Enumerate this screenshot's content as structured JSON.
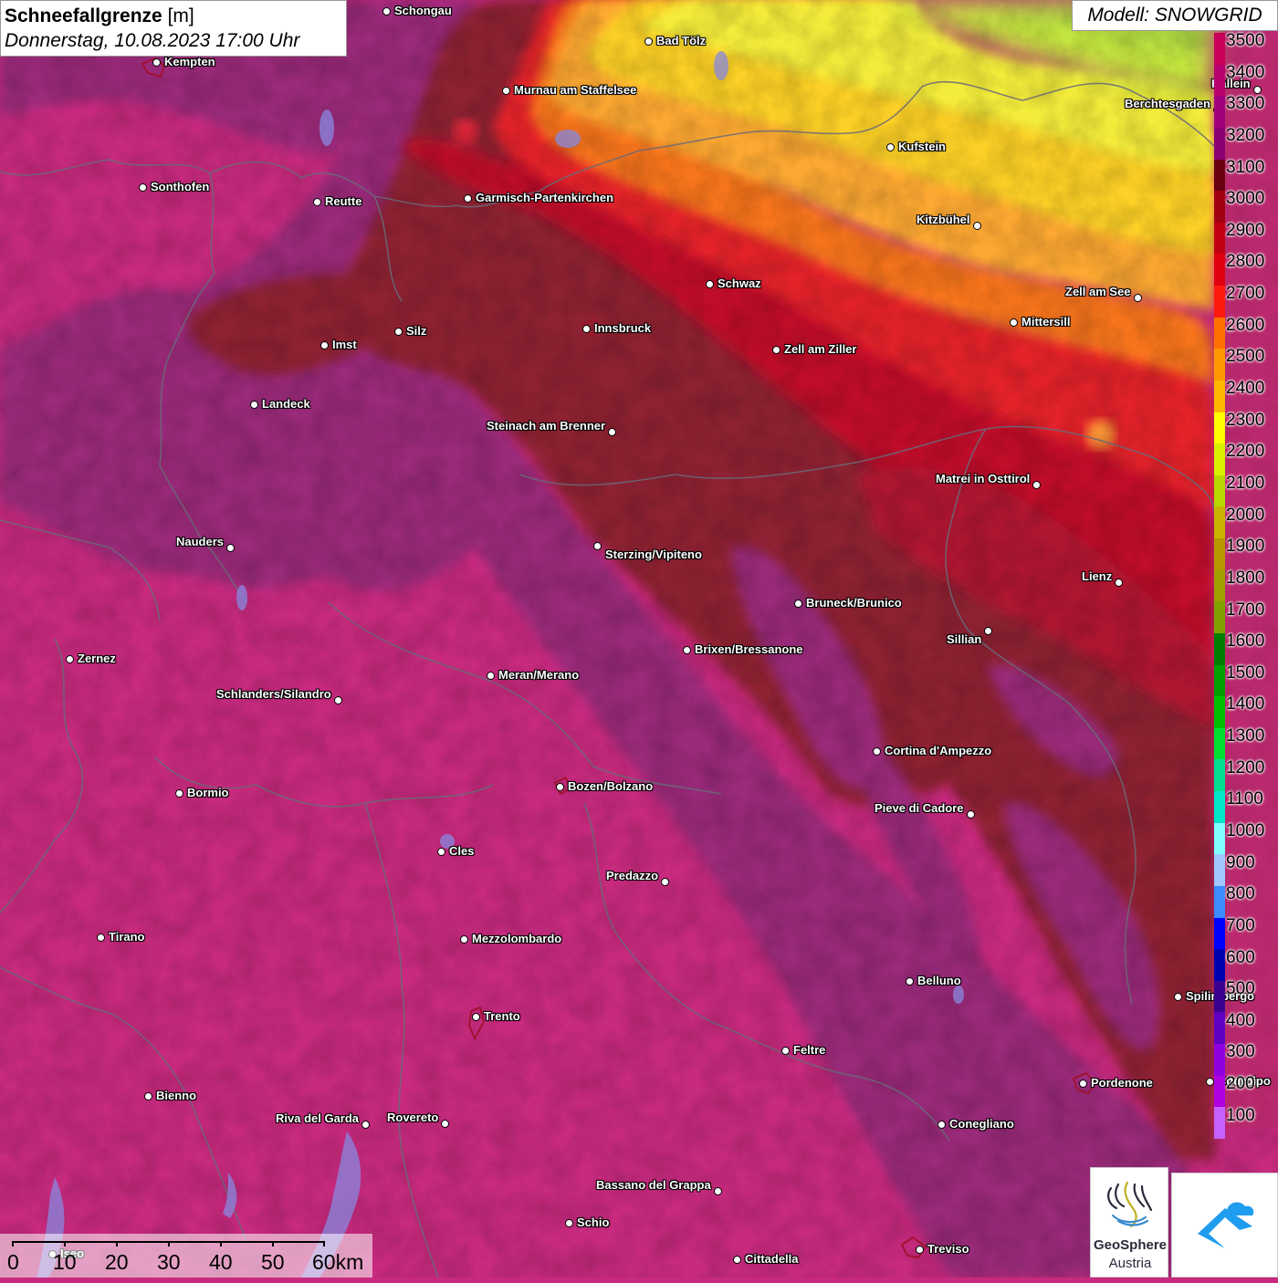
{
  "header": {
    "title": "Schneefallgrenze",
    "unit": "[m]",
    "datetime": "Donnerstag, 10.08.2023 17:00 Uhr",
    "model": "Modell: SNOWGRID"
  },
  "legend": {
    "labels": [
      "3500",
      "3400",
      "3300",
      "3200",
      "3100",
      "3000",
      "2900",
      "2800",
      "2700",
      "2600",
      "2500",
      "2400",
      "2300",
      "2200",
      "2100",
      "2000",
      "1900",
      "1800",
      "1700",
      "1600",
      "1500",
      "1400",
      "1300",
      "1200",
      "1100",
      "1000",
      "900",
      "800",
      "700",
      "600",
      "500",
      "400",
      "300",
      "200",
      "100"
    ],
    "colors": [
      "#c8005a",
      "#b8006e",
      "#a0007c",
      "#8a0072",
      "#6a0010",
      "#a00010",
      "#c00010",
      "#e00010",
      "#ff1a10",
      "#ff7000",
      "#ff9800",
      "#ffb800",
      "#ffff00",
      "#d8f000",
      "#b8d800",
      "#c8b400",
      "#b89800",
      "#a0a000",
      "#80a000",
      "#008000",
      "#00a000",
      "#00c000",
      "#00e030",
      "#00e090",
      "#00e8c8",
      "#80ffff",
      "#a0c8ff",
      "#3c8cff",
      "#0000ff",
      "#0000b0",
      "#3c0090",
      "#6000c0",
      "#9000e0",
      "#b000e0",
      "#c860ff"
    ]
  },
  "scalebar": {
    "labels": [
      "0",
      "10",
      "20",
      "30",
      "40",
      "50",
      "60km"
    ]
  },
  "cities": [
    {
      "name": "Schongau"
    },
    {
      "name": "Kempten"
    },
    {
      "name": "Bad Tölz"
    },
    {
      "name": "Murnau am Staffelsee"
    },
    {
      "name": "Hallein"
    },
    {
      "name": "Berchtesgaden"
    },
    {
      "name": "Kufstein"
    },
    {
      "name": "Sonthofen"
    },
    {
      "name": "Reutte"
    },
    {
      "name": "Garmisch-Partenkirchen"
    },
    {
      "name": "Kitzbühel"
    },
    {
      "name": "Schwaz"
    },
    {
      "name": "Zell am See"
    },
    {
      "name": "Mittersill"
    },
    {
      "name": "Imst"
    },
    {
      "name": "Silz"
    },
    {
      "name": "Innsbruck"
    },
    {
      "name": "Zell am Ziller"
    },
    {
      "name": "Landeck"
    },
    {
      "name": "Steinach am Brenner"
    },
    {
      "name": "Matrei in Osttirol"
    },
    {
      "name": "Nauders"
    },
    {
      "name": "Sterzing/Vipiteno"
    },
    {
      "name": "Lienz"
    },
    {
      "name": "Bruneck/Brunico"
    },
    {
      "name": "Sillian"
    },
    {
      "name": "Brixen/Bressanone"
    },
    {
      "name": "Zernez"
    },
    {
      "name": "Meran/Merano"
    },
    {
      "name": "Schlanders/Silandro"
    },
    {
      "name": "Cortina d'Ampezzo"
    },
    {
      "name": "Bozen/Bolzano"
    },
    {
      "name": "Bormio"
    },
    {
      "name": "Pieve di Cadore"
    },
    {
      "name": "Cles"
    },
    {
      "name": "Predazzo"
    },
    {
      "name": "Tirano"
    },
    {
      "name": "Mezzolombardo"
    },
    {
      "name": "Belluno"
    },
    {
      "name": "Spilimbergo"
    },
    {
      "name": "Trento"
    },
    {
      "name": "Feltre"
    },
    {
      "name": "Pordenone"
    },
    {
      "name": "Codroipo"
    },
    {
      "name": "Bienno"
    },
    {
      "name": "Riva del Garda"
    },
    {
      "name": "Rovereto"
    },
    {
      "name": "Conegliano"
    },
    {
      "name": "Bassano del Grappa"
    },
    {
      "name": "Schio"
    },
    {
      "name": "Treviso"
    },
    {
      "name": "Cittadella"
    },
    {
      "name": "Iseo"
    }
  ],
  "logos": {
    "geosphere_line1": "GeoSphere",
    "geosphere_line2": "Austria"
  }
}
